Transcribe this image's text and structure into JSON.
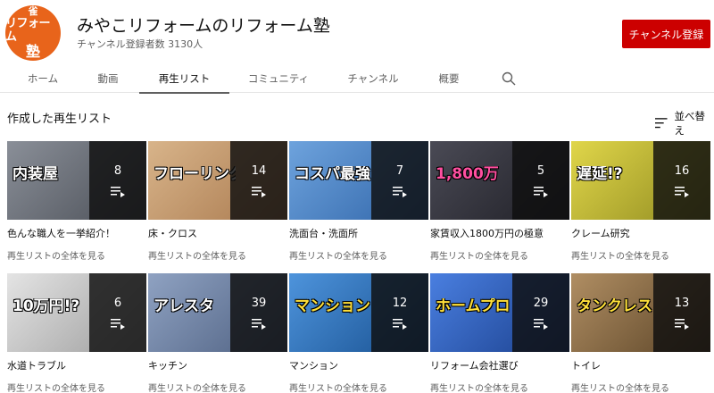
{
  "channel": {
    "name": "みやこリフォームのリフォーム塾",
    "subscribers": "チャンネル登録者数 3130人",
    "subscribe_label": "チャンネル登録",
    "logo": {
      "top": "雀",
      "middle": "リフォーム",
      "bottom": "塾"
    }
  },
  "tabs": [
    {
      "label": "ホーム"
    },
    {
      "label": "動画"
    },
    {
      "label": "再生リスト"
    },
    {
      "label": "コミュニティ"
    },
    {
      "label": "チャンネル"
    },
    {
      "label": "概要"
    }
  ],
  "section": {
    "title": "作成した再生リスト",
    "sort_label": "並べ替え"
  },
  "playlists": [
    {
      "title": "色んな職人を一挙紹介！",
      "count": "8",
      "link": "再生リストの全体を見る",
      "thumb_text": "内装屋",
      "thumb_color": "#6a6f78"
    },
    {
      "title": "床・クロス",
      "count": "14",
      "link": "再生リストの全体を見る",
      "thumb_text": "フローリング",
      "thumb_color": "#c9a077"
    },
    {
      "title": "洗面台・洗面所",
      "count": "7",
      "link": "再生リストの全体を見る",
      "thumb_text": "コスパ最強",
      "thumb_color": "#4f86c6"
    },
    {
      "title": "家賃収入1800万円の極意",
      "count": "5",
      "link": "再生リストの全体を見る",
      "thumb_text": "1,800万",
      "thumb_color": "#3a3a42"
    },
    {
      "title": "クレーム研究",
      "count": "16",
      "link": "再生リストの全体を見る",
      "thumb_text": "遅延!?",
      "thumb_color": "#c7c23a"
    },
    {
      "title": "水道トラブル",
      "count": "6",
      "link": "再生リストの全体を見る",
      "thumb_text": "10万円!?",
      "thumb_color": "#c9c9c9"
    },
    {
      "title": "キッチン",
      "count": "39",
      "link": "再生リストの全体を見る",
      "thumb_text": "アレスタ",
      "thumb_color": "#6b7fa1"
    },
    {
      "title": "マンション",
      "count": "12",
      "link": "再生リストの全体を見る",
      "thumb_text": "マンション",
      "thumb_color": "#2b6fb3"
    },
    {
      "title": "リフォーム会社選び",
      "count": "29",
      "link": "再生リストの全体を見る",
      "thumb_text": "ホームプロ",
      "thumb_color": "#2a5bb8"
    },
    {
      "title": "トイレ",
      "count": "13",
      "link": "再生リストの全体を見る",
      "thumb_text": "タンクレス",
      "thumb_color": "#8a6d4a"
    }
  ],
  "icons": {
    "search": "search-icon",
    "sort": "sort-icon",
    "playlist": "playlist-icon"
  },
  "colors": {
    "subscribe": "#cc0000",
    "avatar": "#e8641b"
  }
}
